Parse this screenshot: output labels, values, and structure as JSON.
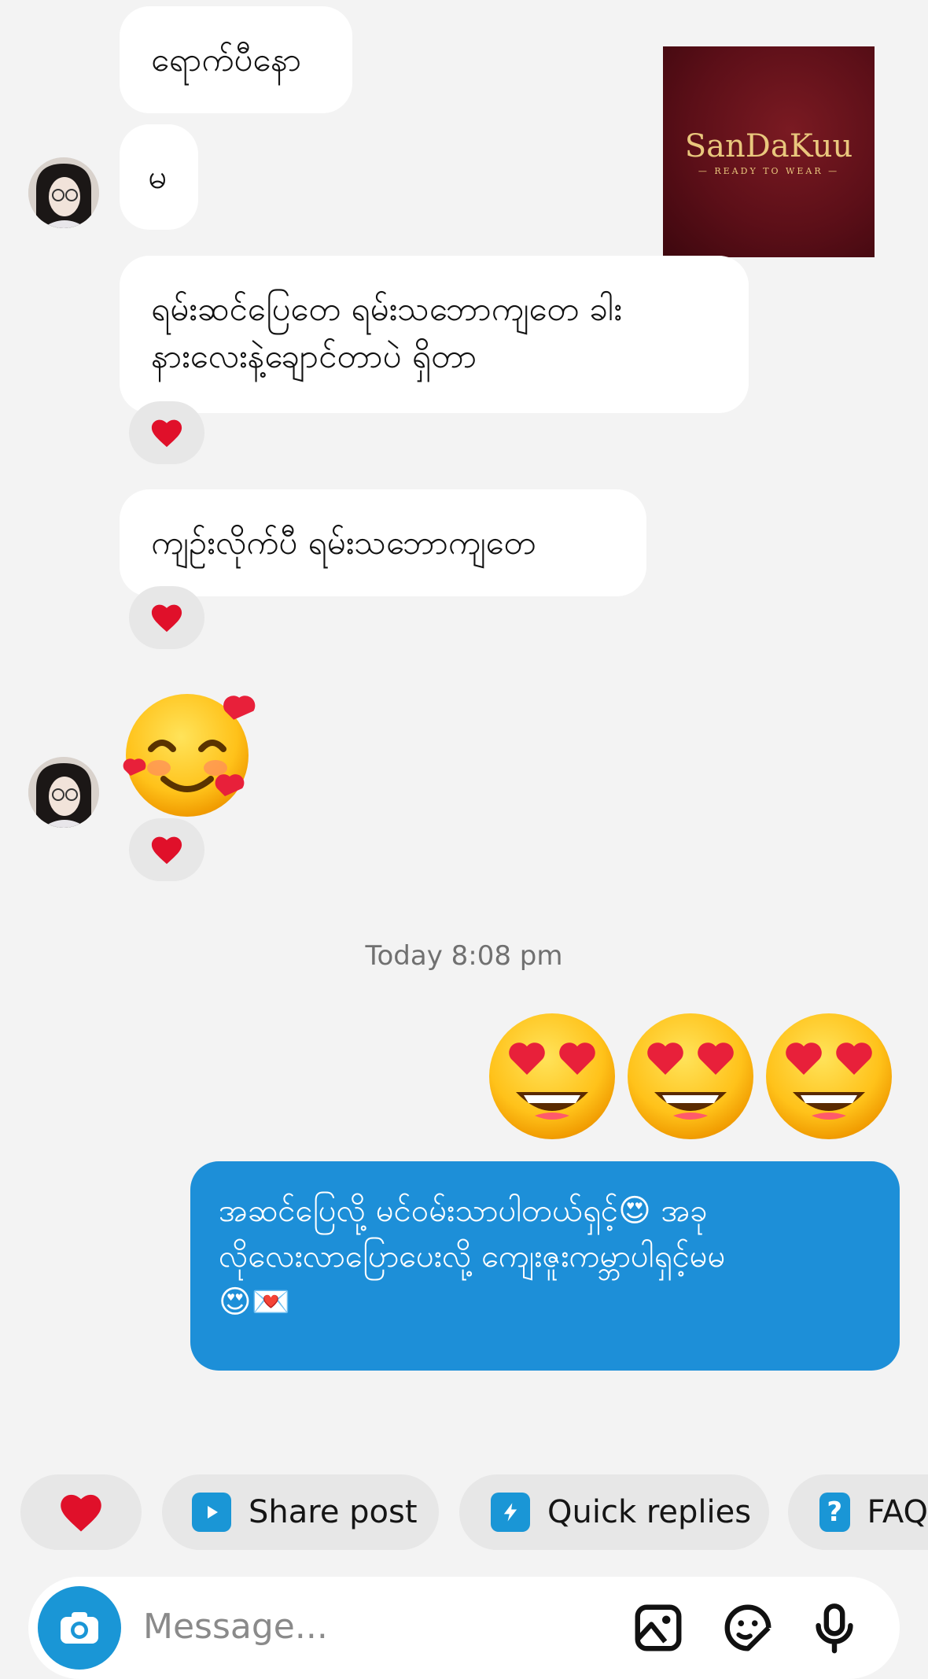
{
  "conversation": {
    "messages_in": [
      {
        "text": "ရောက်ပီနော"
      },
      {
        "text": "မ"
      },
      {
        "text": "ရမ်းဆင်ပြေတေ ရမ်းသဘောကျတေ ခါး\nနားလေးနဲ့ချောင်တာပဲ ရှိတာ"
      },
      {
        "text": "ကျဥ်းလိုက်ပီ ရမ်းသဘောကျတေ"
      }
    ],
    "sticker_in": "smiling-face-with-hearts",
    "timestamp": "Today 8:08 pm",
    "emoji_out": "😍😍😍",
    "message_out": "အဆင်ပြေလို့ မင်ဝမ်းသာပါတယ်ရှင့်😍 အခု\nလိုလေးလာပြောပေးလို့ ကျေးဇူးကမ္ဘာပါရှင့်မမ\n😍💌",
    "reaction": "❤️"
  },
  "brand_logo": {
    "name": "SanDaKuu",
    "tagline": "— READY TO WEAR —"
  },
  "quick_actions": [
    {
      "label": "",
      "icon": "heart-icon"
    },
    {
      "label": "Share post",
      "icon": "share-post-icon"
    },
    {
      "label": "Quick replies",
      "icon": "lightning-icon"
    },
    {
      "label": "FAQ",
      "icon": "question-icon"
    }
  ],
  "composer": {
    "placeholder": "Message..."
  },
  "colors": {
    "outgoing_bubble": "#1d8fd8",
    "background": "#f3f3f3",
    "incoming_bubble": "#ffffff",
    "accent": "#1a96d6",
    "heart": "#e0102a"
  }
}
